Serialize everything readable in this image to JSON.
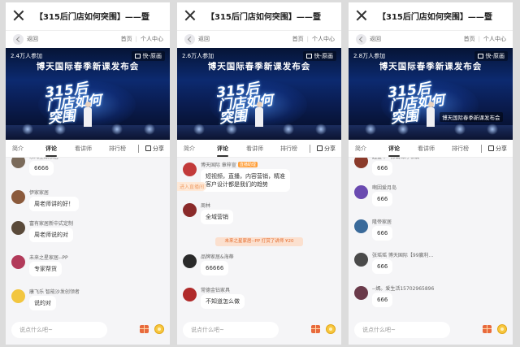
{
  "colors": {
    "accent": "#ff9f3a",
    "gift_bg": "#fbe0cf",
    "video_bg": "#0c2a70"
  },
  "panels": [
    {
      "title": "【315后门店如何突围】——暨",
      "back_label": "返回",
      "nav_home": "首页",
      "nav_user": "个人中心",
      "viewers": "2.4万人参加",
      "quality": "快-原画",
      "banner": "博天国际春季新课发布会",
      "big_text": [
        "315后",
        "门店如何",
        "突围"
      ],
      "overlay": "",
      "tabs": [
        "简介",
        "评论",
        "看讲师",
        "排行榜"
      ],
      "share": "分享",
      "input_placeholder": "说点什么吧~",
      "floating": "",
      "gift": "",
      "comments": [
        {
          "name": "东鸿全品家居",
          "text": "6666",
          "avatar": "#7a6a5a"
        },
        {
          "name": "伊家家居",
          "text": "周老师讲的好！",
          "avatar": "#8b5a3c"
        },
        {
          "name": "富有家居新中式定制",
          "text": "周老师说的对",
          "avatar": "#5a4a3a"
        },
        {
          "name": "未来之星家居--PP",
          "text": "专家帮货",
          "avatar": "#b23a5a"
        },
        {
          "name": "康飞乐 智能沙发创领者",
          "text": "说的对",
          "avatar": "#f2c640"
        }
      ]
    },
    {
      "title": "【315后门店如何突围】——暨",
      "back_label": "返回",
      "nav_home": "首页",
      "nav_user": "个人中心",
      "viewers": "2.6万人参加",
      "quality": "快-原画",
      "banner": "博天国际春季新课发布会",
      "big_text": [
        "315后",
        "门店如何",
        "突围"
      ],
      "overlay": "",
      "tabs": [
        "简介",
        "评论",
        "看讲师",
        "排行榜"
      ],
      "share": "分享",
      "input_placeholder": "说点什么吧~",
      "floating": "进入直播间",
      "gift": "未来之星家居--PP 打赏了讲师 ¥20",
      "comments": [
        {
          "name": "博天国际 章梓宣",
          "tag": "直播助理",
          "text": "短视频，直播，内容营销，精准\n客户设计都是我们的趋势",
          "avatar": "#c23a3a"
        },
        {
          "name": "周林",
          "text": "全域营销",
          "avatar": "#8a2a2a"
        },
        {
          "name": "品牌家居&海蒂",
          "text": "66666",
          "avatar": "#2a2a2a"
        },
        {
          "name": "常德金钻家具",
          "text": "不知道怎么做",
          "avatar": "#b02a2a"
        }
      ]
    },
    {
      "title": "【315后门店如何突围】——暨",
      "back_label": "返回",
      "nav_home": "首页",
      "nav_user": "个人中心",
      "viewers": "2.8万人参加",
      "quality": "快-原画",
      "banner": "博天国际春季新课发布会",
      "big_text": [
        "315后",
        "门店如何",
        "突围"
      ],
      "overlay": "博天国际春季新课发布会",
      "tabs": [
        "简介",
        "评论",
        "看讲师",
        "排行榜"
      ],
      "share": "分享",
      "input_placeholder": "说点什么吧~",
      "floating": "",
      "gift": "",
      "comments": [
        {
          "name": "起盛华--佛山锦淳软装",
          "text": "666",
          "avatar": "#8a3a2a"
        },
        {
          "name": "啊因爱月岛",
          "text": "666",
          "avatar": "#6a4ab0"
        },
        {
          "name": "隆帝家居",
          "text": "666",
          "avatar": "#3a6a9a"
        },
        {
          "name": "张瑶瑶 博天国际【99赢利...",
          "text": "666",
          "avatar": "#4a4a4a"
        },
        {
          "name": "--嫣。爱生活15702965896",
          "text": "666",
          "avatar": "#6a3a4a"
        }
      ]
    }
  ]
}
